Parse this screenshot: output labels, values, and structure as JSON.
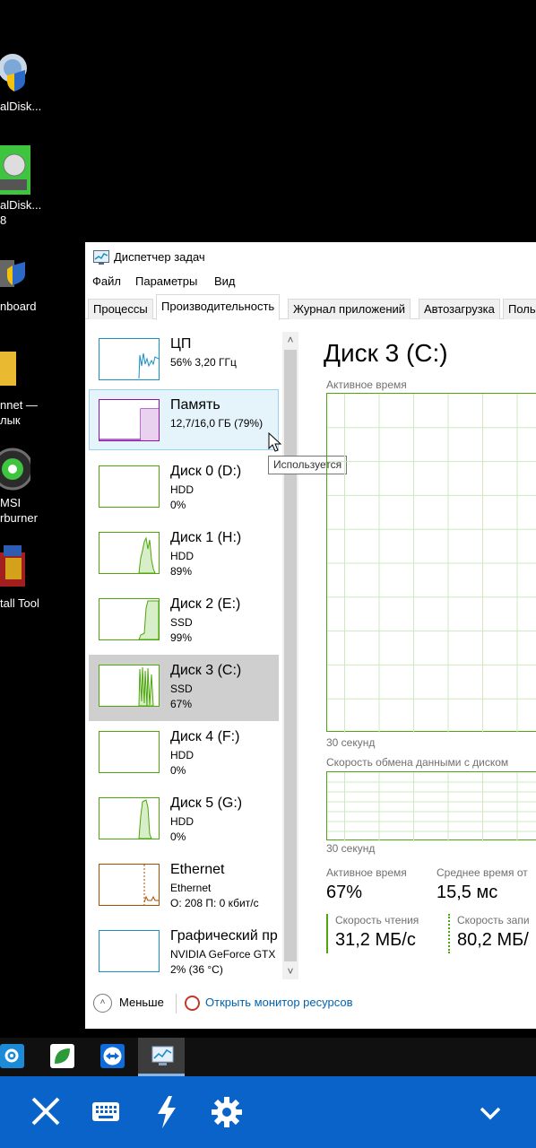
{
  "desktop": {
    "icons": [
      {
        "label": "alDisk..."
      },
      {
        "label": "alDisk...\n8"
      },
      {
        "label": "nboard"
      },
      {
        "label": "nnet —\nлык"
      },
      {
        "label": "MSI\nrburner"
      },
      {
        "label": "tall Tool"
      }
    ]
  },
  "window": {
    "title": "Диспетчер задач",
    "menu": [
      "Файл",
      "Параметры",
      "Вид"
    ],
    "tabs": [
      "Процессы",
      "Производительность",
      "Журнал приложений",
      "Автозагрузка",
      "Поль"
    ],
    "active_tab": "Производительность"
  },
  "sidebar": {
    "items": [
      {
        "name": "ЦП",
        "sub": "56% 3,20 ГГц",
        "sub2": "",
        "color": "#1a8fc4"
      },
      {
        "name": "Память",
        "sub": "12,7/16,0 ГБ (79%)",
        "sub2": "",
        "color": "#8b12ae"
      },
      {
        "name": "Диск 0 (D:)",
        "sub": "HDD",
        "sub2": "0%",
        "color": "#4da60c"
      },
      {
        "name": "Диск 1 (H:)",
        "sub": "HDD",
        "sub2": "89%",
        "color": "#4da60c"
      },
      {
        "name": "Диск 2 (E:)",
        "sub": "SSD",
        "sub2": "99%",
        "color": "#4da60c"
      },
      {
        "name": "Диск 3 (C:)",
        "sub": "SSD",
        "sub2": "67%",
        "color": "#4da60c"
      },
      {
        "name": "Диск 4 (F:)",
        "sub": "HDD",
        "sub2": "0%",
        "color": "#4da60c"
      },
      {
        "name": "Диск 5 (G:)",
        "sub": "HDD",
        "sub2": "0%",
        "color": "#4da60c"
      },
      {
        "name": "Ethernet",
        "sub": "Ethernet",
        "sub2": "О: 208 П: 0 кбит/с",
        "color": "#a74f01"
      },
      {
        "name": "Графический пр",
        "sub": "NVIDIA GeForce GTX",
        "sub2": "2% (36 °C)",
        "color": "#1a8fc4"
      }
    ],
    "tooltip": "Используется"
  },
  "main": {
    "title": "Диск 3 (C:)",
    "active_time_label": "Активное время",
    "time_label_1": "30 секунд",
    "transfer_label": "Скорость обмена данными с диском",
    "time_label_2": "30 секунд",
    "stats": {
      "active_time_label": "Активное время",
      "active_time_value": "67%",
      "avg_response_label": "Среднее время от",
      "avg_response_value": "15,5 мс",
      "read_label": "Скорость чтения",
      "read_value": "31,2 МБ/с",
      "write_label": "Скорость запи",
      "write_value": "80,2 МБ/"
    }
  },
  "footer": {
    "less": "Меньше",
    "monitor": "Открыть монитор ресурсов"
  },
  "colors": {
    "disk_green": "#4da60c",
    "memory_purple": "#8b12ae",
    "cpu_blue": "#1a8fc4",
    "ethernet_orange": "#a74f01",
    "bottom_bar": "#0a63c8"
  }
}
